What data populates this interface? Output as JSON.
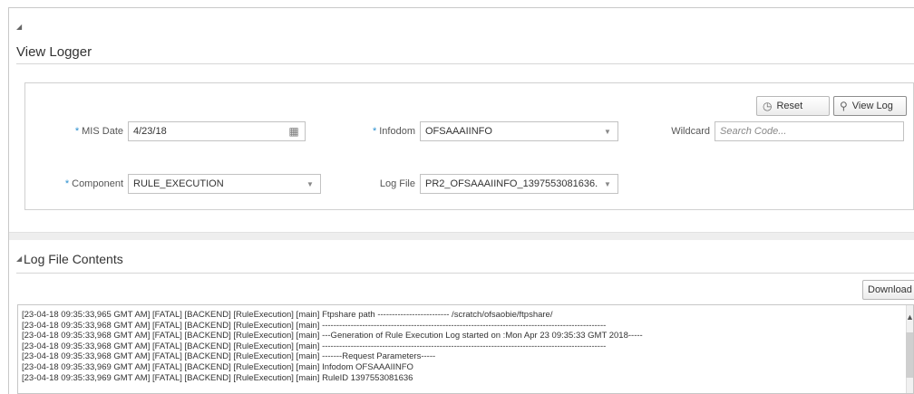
{
  "header": {
    "collapse_glyph": "◢",
    "title": "View Logger"
  },
  "toolbar": {
    "reset_label": "Reset",
    "reset_icon": "clock-icon",
    "view_log_label": "View Log",
    "view_log_icon": "search-icon"
  },
  "form": {
    "mis_date": {
      "label": "MIS Date",
      "required": true,
      "value": "4/23/18",
      "icon": "calendar-icon"
    },
    "infodom": {
      "label": "Infodom",
      "required": true,
      "value": "OFSAAAIINFO"
    },
    "wildcard": {
      "label": "Wildcard",
      "required": false,
      "placeholder": "Search Code..."
    },
    "component": {
      "label": "Component",
      "required": true,
      "value": "RULE_EXECUTION"
    },
    "log_file": {
      "label": "Log File",
      "required": false,
      "value": "PR2_OFSAAAIINFO_1397553081636..."
    }
  },
  "log_section": {
    "collapse_glyph": "◢",
    "title": "Log File Contents",
    "download_label": "Download",
    "lines": [
      "[23-04-18 09:35:33,965 GMT AM]  [FATAL]  [BACKEND]  [RuleExecution]  [main]  Ftpshare path -------------------------  /scratch/ofsaobie/ftpshare/",
      "[23-04-18 09:35:33,968 GMT AM]  [FATAL]  [BACKEND]  [RuleExecution]  [main]  ---------------------------------------------------------------------------------------------------",
      "[23-04-18 09:35:33,968 GMT AM]  [FATAL]  [BACKEND]  [RuleExecution]  [main]  ---Generation of Rule Execution Log started on :Mon Apr 23 09:35:33 GMT 2018-----",
      "[23-04-18 09:35:33,968 GMT AM]  [FATAL]  [BACKEND]  [RuleExecution]  [main]  ---------------------------------------------------------------------------------------------------",
      "[23-04-18 09:35:33,968 GMT AM]  [FATAL]  [BACKEND]  [RuleExecution]  [main]  -------Request Parameters-----",
      "[23-04-18 09:35:33,969 GMT AM]  [FATAL]  [BACKEND]  [RuleExecution]  [main]  Infodom OFSAAAIINFO",
      "[23-04-18 09:35:33,969 GMT AM]  [FATAL]  [BACKEND]  [RuleExecution]  [main]  RuleID 1397553081636"
    ]
  }
}
